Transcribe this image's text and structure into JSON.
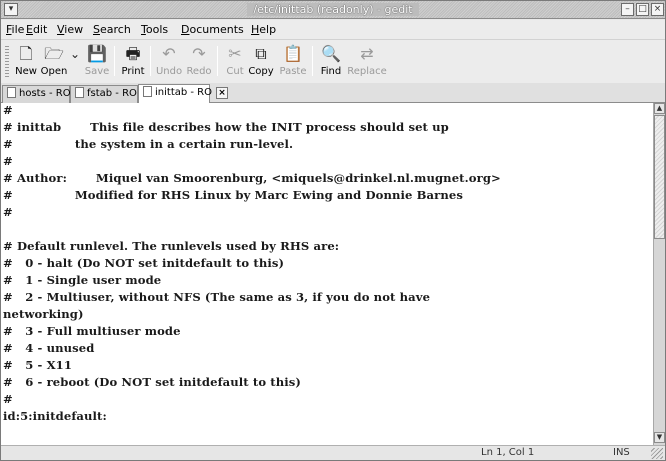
{
  "window": {
    "title": "/etc/inittab (readonly) - gedit",
    "controls": {
      "menu_glyph": "▾",
      "minimize_glyph": "–",
      "maximize_glyph": "□",
      "close_glyph": "×"
    }
  },
  "menubar": {
    "items": [
      "File",
      "Edit",
      "View",
      "Search",
      "Tools",
      "Documents",
      "Help"
    ]
  },
  "toolbar": {
    "buttons": [
      {
        "label": "New",
        "icon": "new-document-icon",
        "glyph": "🗋",
        "enabled": true
      },
      {
        "label": "Open",
        "icon": "open-folder-icon",
        "glyph": "🗁",
        "enabled": true
      },
      {
        "label": "Save",
        "icon": "save-icon",
        "glyph": "💾",
        "enabled": false
      },
      {
        "label": "Print",
        "icon": "print-icon",
        "glyph": "🖶",
        "enabled": true
      },
      {
        "label": "Undo",
        "icon": "undo-icon",
        "glyph": "↶",
        "enabled": false
      },
      {
        "label": "Redo",
        "icon": "redo-icon",
        "glyph": "↷",
        "enabled": false
      },
      {
        "label": "Cut",
        "icon": "cut-icon",
        "glyph": "✂",
        "enabled": false
      },
      {
        "label": "Copy",
        "icon": "copy-icon",
        "glyph": "⧉",
        "enabled": true
      },
      {
        "label": "Paste",
        "icon": "paste-icon",
        "glyph": "📋",
        "enabled": false
      },
      {
        "label": "Find",
        "icon": "find-icon",
        "glyph": "🔍",
        "enabled": true
      },
      {
        "label": "Replace",
        "icon": "replace-icon",
        "glyph": "⇄",
        "enabled": false
      }
    ],
    "open_dropdown_glyph": "⌄"
  },
  "tabs": [
    {
      "label": "hosts - RO",
      "active": false,
      "close_glyph": "×"
    },
    {
      "label": "fstab - RO",
      "active": false,
      "close_glyph": "×"
    },
    {
      "label": "inittab - RO",
      "active": true,
      "close_glyph": "×"
    }
  ],
  "editor": {
    "lines": [
      "#",
      "# inittab       This file describes how the INIT process should set up",
      "#               the system in a certain run-level.",
      "#",
      "# Author:       Miquel van Smoorenburg, <miquels@drinkel.nl.mugnet.org>",
      "#               Modified for RHS Linux by Marc Ewing and Donnie Barnes",
      "#",
      "",
      "# Default runlevel. The runlevels used by RHS are:",
      "#   0 - halt (Do NOT set initdefault to this)",
      "#   1 - Single user mode",
      "#   2 - Multiuser, without NFS (The same as 3, if you do not have",
      "networking)",
      "#   3 - Full multiuser mode",
      "#   4 - unused",
      "#   5 - X11",
      "#   6 - reboot (Do NOT set initdefault to this)",
      "#",
      "id:5:initdefault:"
    ]
  },
  "scrollbar": {
    "up_glyph": "▲",
    "down_glyph": "▼"
  },
  "statusbar": {
    "position": "Ln 1, Col 1",
    "mode": "INS"
  }
}
